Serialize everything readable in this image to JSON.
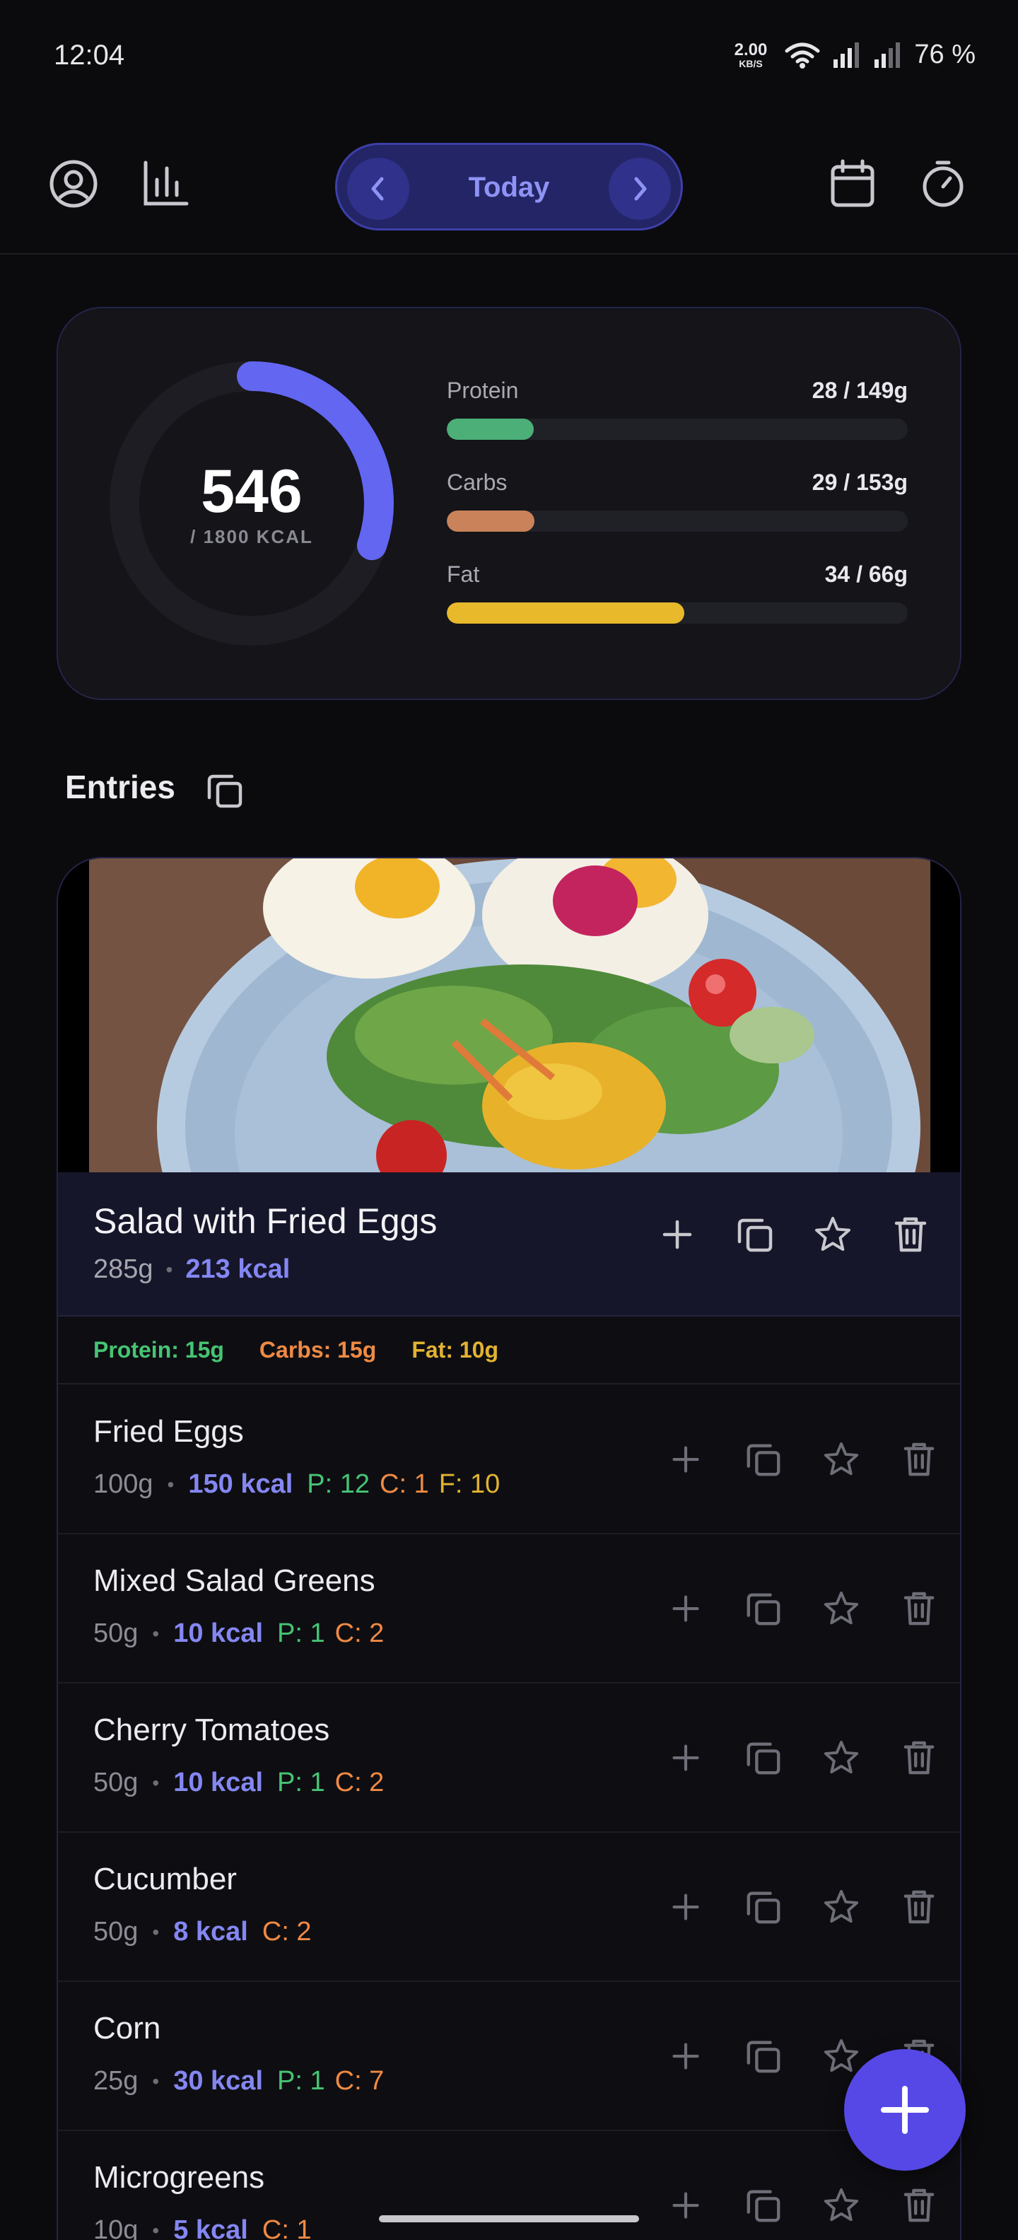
{
  "status_bar": {
    "time": "12:04",
    "net_speed_value": "2.00",
    "net_speed_unit": "KB/S",
    "battery": "76 %"
  },
  "nav": {
    "date_label": "Today",
    "icons": [
      "profile-icon",
      "stats-icon",
      "prev-day-icon",
      "next-day-icon",
      "calendar-icon",
      "timer-icon"
    ]
  },
  "summary": {
    "calories": "546",
    "calorie_goal_label": "/ 1800 KCAL",
    "calorie_progress": 0.3033,
    "macros": [
      {
        "name": "Protein",
        "value": "28 / 149g",
        "progress": 0.188,
        "color": "#4caf78"
      },
      {
        "name": "Carbs",
        "value": "29 / 153g",
        "progress": 0.19,
        "color": "#c9825a"
      },
      {
        "name": "Fat",
        "value": "34 / 66g",
        "progress": 0.515,
        "color": "#e9b92c"
      }
    ],
    "ring_color": "#6366f1"
  },
  "entries": {
    "title": "Entries"
  },
  "meal": {
    "name": "Salad with Fried Eggs",
    "weight": "285g",
    "kcal": "213 kcal",
    "protein": "Protein: 15g",
    "carbs": "Carbs: 15g",
    "fat": "Fat: 10g",
    "items": [
      {
        "name": "Fried Eggs",
        "weight": "100g",
        "kcal": "150 kcal",
        "p": "P: 12",
        "c": "C: 1",
        "f": "F: 10"
      },
      {
        "name": "Mixed Salad Greens",
        "weight": "50g",
        "kcal": "10 kcal",
        "p": "P: 1",
        "c": "C: 2",
        "f": ""
      },
      {
        "name": "Cherry Tomatoes",
        "weight": "50g",
        "kcal": "10 kcal",
        "p": "P: 1",
        "c": "C: 2",
        "f": ""
      },
      {
        "name": "Cucumber",
        "weight": "50g",
        "kcal": "8 kcal",
        "p": "",
        "c": "C: 2",
        "f": ""
      },
      {
        "name": "Corn",
        "weight": "25g",
        "kcal": "30 kcal",
        "p": "P: 1",
        "c": "C: 7",
        "f": ""
      },
      {
        "name": "Microgreens",
        "weight": "10g",
        "kcal": "5 kcal",
        "p": "",
        "c": "C: 1",
        "f": ""
      }
    ]
  },
  "colors": {
    "accent": "#6366f1",
    "protein": "#46c474",
    "carbs": "#ef8a44",
    "fat": "#e2b232",
    "fab": "#5648e6"
  }
}
